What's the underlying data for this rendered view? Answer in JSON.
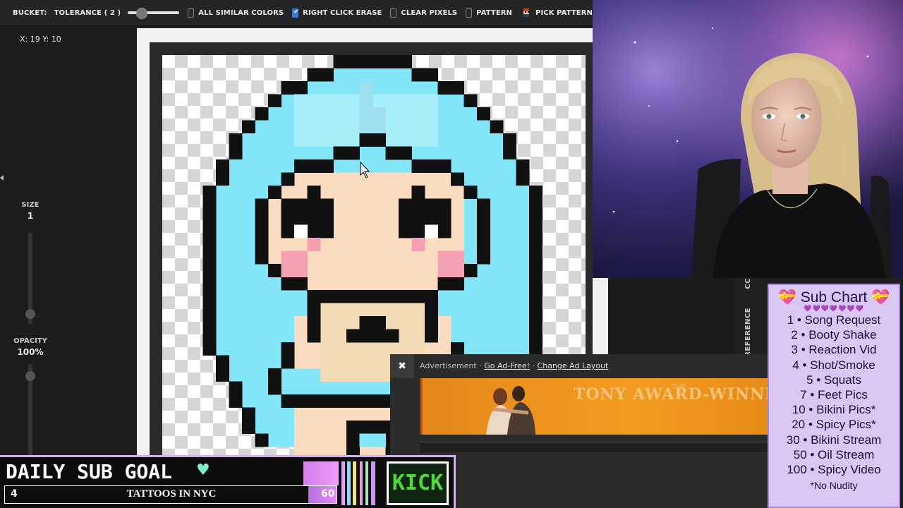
{
  "toolbar": {
    "bucket_label": "BUCKET:",
    "tolerance_label": "TOLERANCE ( 2 )",
    "all_similar_colors": "ALL SIMILAR COLORS",
    "right_click_erase": "RIGHT CLICK ERASE",
    "clear_pixels": "CLEAR PIXELS",
    "pattern": "PATTERN",
    "pick_pattern": "PICK PATTERN",
    "tolerance_level": 2,
    "checks": {
      "all_similar_colors": false,
      "right_click_erase": true,
      "clear_pixels": false,
      "pattern": false
    }
  },
  "coords": "X: 19 Y: 10",
  "left_panel": {
    "size_label": "SIZE",
    "size_value": "1",
    "opacity_label": "OPACITY",
    "opacity_value": "100%"
  },
  "reference_panel": {
    "cc": "CC",
    "reference": "REFERENCE"
  },
  "ad": {
    "close_glyph": "✖",
    "advertisement": "Advertisement · ",
    "go_ad_free": "Go Ad-Free!",
    "separator": " · ",
    "change_layout": "Change Ad Layout",
    "banner_kicker": "THE",
    "banner_text": "TONY AWARD-WINNI"
  },
  "sub_chart": {
    "title": "💝 Sub Chart 💝",
    "hearts": "💜💜💜💜💜💜💜",
    "items": [
      "1 • Song Request",
      "2 • Booty Shake",
      "3 • Reaction Vid",
      "4 • Shot/Smoke",
      "5 • Squats",
      "7 • Feet Pics",
      "10 • Bikini Pics*",
      "20 • Spicy Pics*",
      "30 • Bikini Stream",
      "50 • Oil Stream",
      "100 • Spicy Video"
    ],
    "footer": "*No Nudity"
  },
  "goal": {
    "title": "DAILY SUB GOAL",
    "heart": "♥",
    "current": "4",
    "label": "TATTOOS IN NYC",
    "target": "60",
    "progress_fraction": 0.067,
    "kick": "KICK"
  },
  "colors": {
    "hair": "#82e6f8",
    "hair_light": "#a6eefa",
    "outline": "#111111",
    "skin": "#fcdcc0",
    "blush": "#f4a0b0",
    "dress": "#f2dbb4",
    "accent": "#3a7bd5",
    "sub_chart_bg": "#d9c6f4",
    "kick_green": "#4cdb37"
  },
  "icons": {
    "pick_pattern": "pick-pattern-icon",
    "cursor": "cursor-icon",
    "close": "close-icon",
    "heart": "heart-icon"
  }
}
